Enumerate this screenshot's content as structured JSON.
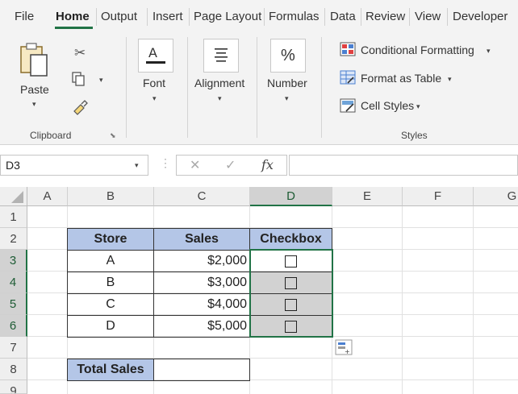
{
  "menu": {
    "tabs": [
      "File",
      "Home",
      "Output",
      "Insert",
      "Page Layout",
      "Formulas",
      "Data",
      "Review",
      "View",
      "Developer"
    ],
    "active": "Home"
  },
  "ribbon": {
    "clipboard": {
      "paste": "Paste",
      "group_label": "Clipboard"
    },
    "font": {
      "label": "Font"
    },
    "alignment": {
      "label": "Alignment"
    },
    "number": {
      "label": "Number"
    },
    "styles": {
      "conditional_formatting": "Conditional Formatting",
      "format_as_table": "Format as Table",
      "cell_styles": "Cell Styles",
      "group_label": "Styles"
    }
  },
  "formula_bar": {
    "name_box": "D3",
    "fx": "fx",
    "formula": ""
  },
  "sheet": {
    "columns": [
      "A",
      "B",
      "C",
      "D",
      "E",
      "F",
      "G"
    ],
    "rows": [
      "1",
      "2",
      "3",
      "4",
      "5",
      "6",
      "7",
      "8",
      "9"
    ],
    "selected_column": "D",
    "table": {
      "headers": [
        "Store",
        "Sales",
        "Checkbox"
      ],
      "rows": [
        {
          "store": "A",
          "sales": "$2,000",
          "checked": false
        },
        {
          "store": "B",
          "sales": "$3,000",
          "checked": false
        },
        {
          "store": "C",
          "sales": "$4,000",
          "checked": false
        },
        {
          "store": "D",
          "sales": "$5,000",
          "checked": false
        }
      ]
    },
    "total_label": "Total Sales",
    "total_value": ""
  },
  "colors": {
    "accent": "#217346",
    "header_fill": "#b4c6e7",
    "selection_fill": "#d2d2d2"
  }
}
